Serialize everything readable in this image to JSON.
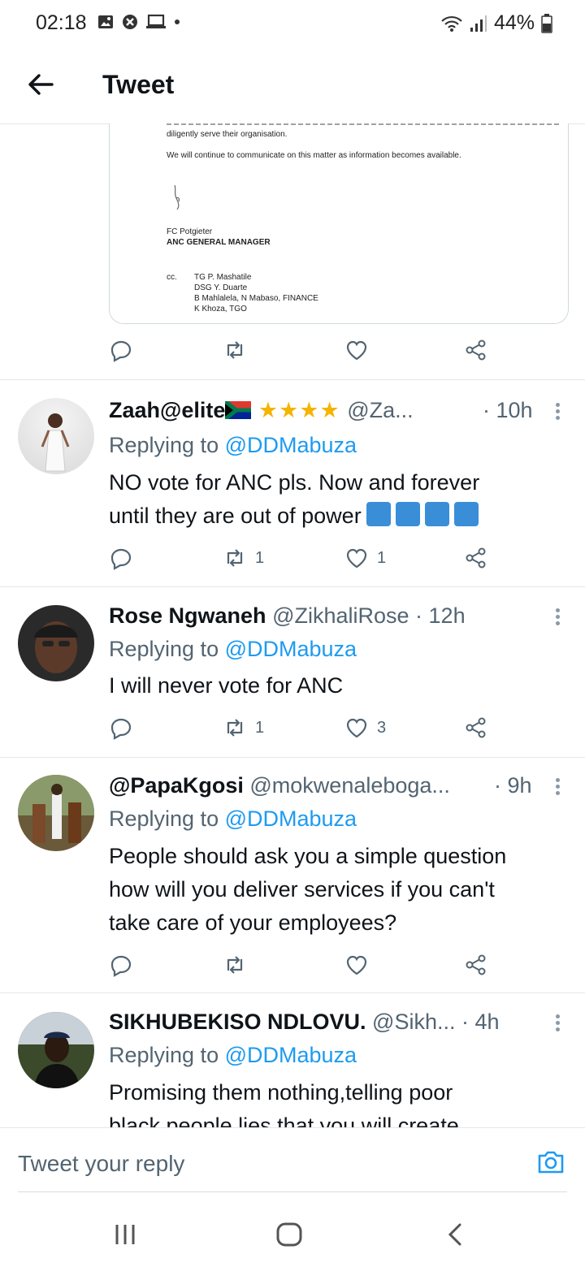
{
  "status_bar": {
    "time": "02:18",
    "battery": "44%"
  },
  "app_bar": {
    "title": "Tweet"
  },
  "document": {
    "lines": [
      "diligently serve their organisation.",
      "We will continue to communicate on this matter as information becomes available.",
      "FC Potgieter",
      "ANC GENERAL MANAGER",
      "cc.",
      "TG P. Mashatile",
      "DSG Y. Duarte",
      "B Mahlalela, N Mabaso, FINANCE",
      "K Khoza, TGO"
    ]
  },
  "tweets": [
    {
      "name": "Zaah@elite",
      "handle": "@Za...",
      "time": "· 10h",
      "replying_prefix": "Replying to",
      "replying_to": "@DDMabuza",
      "text_line1": "NO vote for ANC pls. Now and forever",
      "text_line2": "until they are out of power",
      "retweets": "1",
      "likes": "1"
    },
    {
      "name": "Rose Ngwaneh",
      "handle": "@ZikhaliRose",
      "time": "· 12h",
      "replying_prefix": "Replying to",
      "replying_to": "@DDMabuza",
      "text_line1": "I will never vote for ANC",
      "retweets": "1",
      "likes": "3"
    },
    {
      "name": "@PapaKgosi",
      "handle": "@mokwenaleboga...",
      "time": "· 9h",
      "replying_prefix": "Replying to",
      "replying_to": "@DDMabuza",
      "text_line1": "People should ask you a simple question",
      "text_line2": "how will you deliver services if you can't",
      "text_line3": "take care of your employees?"
    },
    {
      "name": "SIKHUBEKISO NDLOVU.",
      "handle": "@Sikh...",
      "time": "· 4h",
      "replying_prefix": "Replying to",
      "replying_to": "@DDMabuza",
      "text_line1": "Promising them nothing,telling poor",
      "text_line2": "black people lies that you will create"
    }
  ],
  "reply_bar": {
    "placeholder": "Tweet your reply"
  },
  "icons": [
    "gallery-icon",
    "shield-icon",
    "laptop-icon",
    "wifi-icon",
    "signal-icon",
    "battery-icon",
    "back-arrow-icon",
    "reply-icon",
    "retweet-icon",
    "like-icon",
    "share-icon",
    "more-icon",
    "camera-icon",
    "recents-icon",
    "home-icon",
    "back-icon"
  ],
  "colors": {
    "accent": "#1d9bf0",
    "text": "#0f1419",
    "muted": "#536471"
  }
}
